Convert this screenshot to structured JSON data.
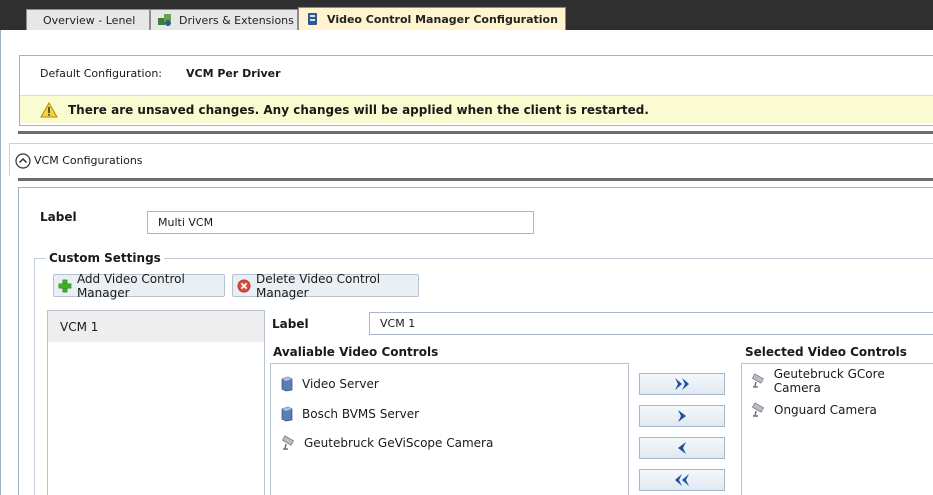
{
  "tabs": [
    {
      "label": "Overview - Lenel",
      "icon": "none"
    },
    {
      "label": "Drivers & Extensions",
      "icon": "puzzle-icon"
    },
    {
      "label": "Video Control Manager Configuration",
      "icon": "vcm-icon",
      "active": true
    }
  ],
  "config": {
    "default_label": "Default Configuration:",
    "default_value": "VCM Per Driver",
    "warning": "There are unsaved changes. Any changes will be applied when the client is restarted."
  },
  "section": {
    "title": "VCM Configurations"
  },
  "form": {
    "label_caption": "Label",
    "label_value": "Multi VCM",
    "custom_settings": "Custom Settings",
    "add_button": "Add Video Control Manager",
    "delete_button": "Delete Video Control Manager"
  },
  "vcm_list": [
    {
      "label": "VCM 1"
    }
  ],
  "detail": {
    "label_caption": "Label",
    "label_value": "VCM 1",
    "available_title": "Avaliable Video Controls",
    "selected_title": "Selected Video Controls"
  },
  "available": [
    {
      "label": "Video Server",
      "icon": "server-icon"
    },
    {
      "label": "Bosch BVMS Server",
      "icon": "server-icon"
    },
    {
      "label": "Geutebruck GeViScope Camera",
      "icon": "camera-icon"
    }
  ],
  "selected": [
    {
      "label": "Geutebruck GCore Camera",
      "icon": "camera-icon"
    },
    {
      "label": "Onguard Camera",
      "icon": "camera-icon"
    }
  ],
  "colors": {
    "accent": "#1f4f9c",
    "tab_active": "#fff4cf",
    "warning_bg": "#fbfbd1"
  }
}
